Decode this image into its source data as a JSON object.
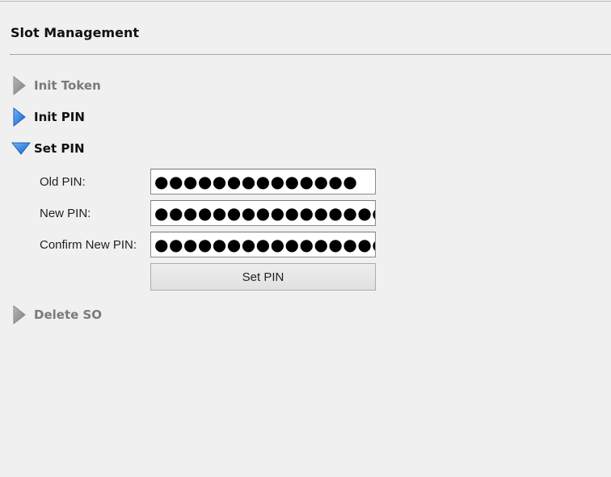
{
  "panel": {
    "title": "Slot Management"
  },
  "sections": [
    {
      "label": "Init Token",
      "state": "collapsed",
      "enabled": false,
      "icon": "triangle-right-gray-icon"
    },
    {
      "label": "Init PIN",
      "state": "collapsed",
      "enabled": true,
      "icon": "triangle-right-blue-icon"
    },
    {
      "label": "Set PIN",
      "state": "expanded",
      "enabled": true,
      "icon": "triangle-down-blue-icon"
    },
    {
      "label": "Delete SO",
      "state": "collapsed",
      "enabled": false,
      "icon": "triangle-right-gray-icon"
    }
  ],
  "set_pin_form": {
    "old_pin_label": "Old PIN:",
    "old_pin_value": "●●●●●●●●●●●●●●",
    "new_pin_label": "New PIN:",
    "new_pin_value": "●●●●●●●●●●●●●●●●",
    "confirm_pin_label": "Confirm New PIN:",
    "confirm_pin_value": "●●●●●●●●●●●●●●●●",
    "submit_label": "Set PIN"
  },
  "colors": {
    "background": "#f0f0f0",
    "accent_blue": "#2a7fd9",
    "disabled_gray": "#8a8a8a"
  }
}
